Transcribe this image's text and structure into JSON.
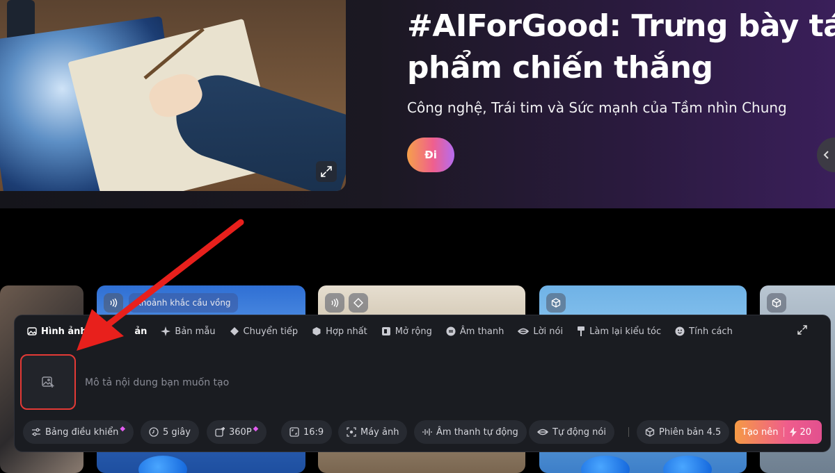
{
  "hero": {
    "title_line1": "#AIForGood: Trưng bày tác",
    "title_line2": "phẩm chiến thắng",
    "subtitle": "Công nghệ, Trái tim và Sức mạnh của Tầm nhìn Chung",
    "go_label": "Đi"
  },
  "cards": [
    {
      "label": ""
    },
    {
      "label": "Khoảnh khắc cầu vồng"
    },
    {
      "label": ""
    },
    {
      "label": ""
    },
    {
      "label": ""
    }
  ],
  "panel": {
    "tabs": [
      {
        "label": "Hình ảnh ho",
        "icon": "image-icon"
      },
      {
        "label": "ản",
        "icon": ""
      },
      {
        "label": "Bản mẫu",
        "icon": "sparkle-icon"
      },
      {
        "label": "Chuyển tiếp",
        "icon": "diamond-icon"
      },
      {
        "label": "Hợp nhất",
        "icon": "cube-icon"
      },
      {
        "label": "Mở rộng",
        "icon": "expand-frame-icon"
      },
      {
        "label": "Âm thanh",
        "icon": "sound-icon"
      },
      {
        "label": "Lời nói",
        "icon": "lips-icon"
      },
      {
        "label": "Làm lại kiểu tóc",
        "icon": "brush-icon"
      },
      {
        "label": "Tính cách",
        "icon": "smiley-icon"
      }
    ],
    "prompt_placeholder": "Mô tả nội dung bạn muốn tạo",
    "options": {
      "control": "Bảng điều khiển",
      "duration": "5 giây",
      "resolution": "360P",
      "ratio": "16:9",
      "camera": "Máy ảnh",
      "auto_sound": "Âm thanh tự động",
      "auto_speak": "Tự động nói",
      "version": "Phiên bản 4.5"
    },
    "create": {
      "label": "Tạo nên",
      "credits": "20"
    }
  },
  "colors": {
    "accent_gradient_start": "#f59a45",
    "accent_gradient_end": "#e2508f",
    "highlight_red": "#e43a36",
    "panel_bg": "#1a1c21"
  }
}
